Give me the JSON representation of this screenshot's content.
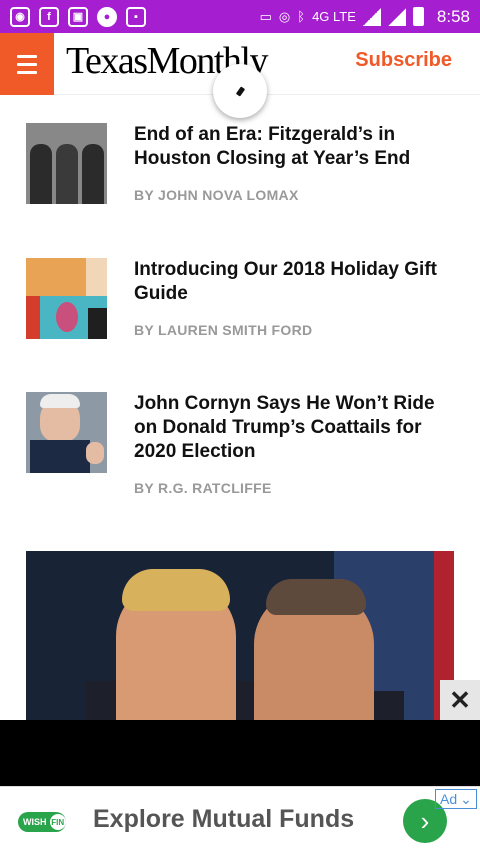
{
  "status_bar": {
    "network": "4G LTE",
    "time": "8:58"
  },
  "header": {
    "logo": "TexasMonthly",
    "subscribe_label": "Subscribe"
  },
  "articles": [
    {
      "title": "End of an Era: Fitzgerald’s in Houston Closing at Year’s End",
      "author": "BY JOHN NOVA LOMAX",
      "thumb_icon": "band-photo"
    },
    {
      "title": "Introducing Our 2018 Holiday Gift Guide",
      "author": "BY LAUREN SMITH FORD",
      "thumb_icon": "gift-guide-illustration"
    },
    {
      "title": "John Cornyn Says He Won’t Ride on Donald Trump’s Coattails for 2020 Election",
      "author": "BY R.G. RATCLIFFE",
      "thumb_icon": "senator-photo"
    }
  ],
  "hero": {
    "image_icon": "politicians-photo"
  },
  "close_ad": "✕",
  "ad": {
    "badge_wish": "WISH",
    "badge_fin": "FIN",
    "text": "Explore Mutual Funds",
    "go_icon": "›",
    "label": "Ad"
  },
  "colors": {
    "status_bar": "#a51fd0",
    "brand_accent": "#f05a28",
    "ad_green": "#2aa44a"
  }
}
